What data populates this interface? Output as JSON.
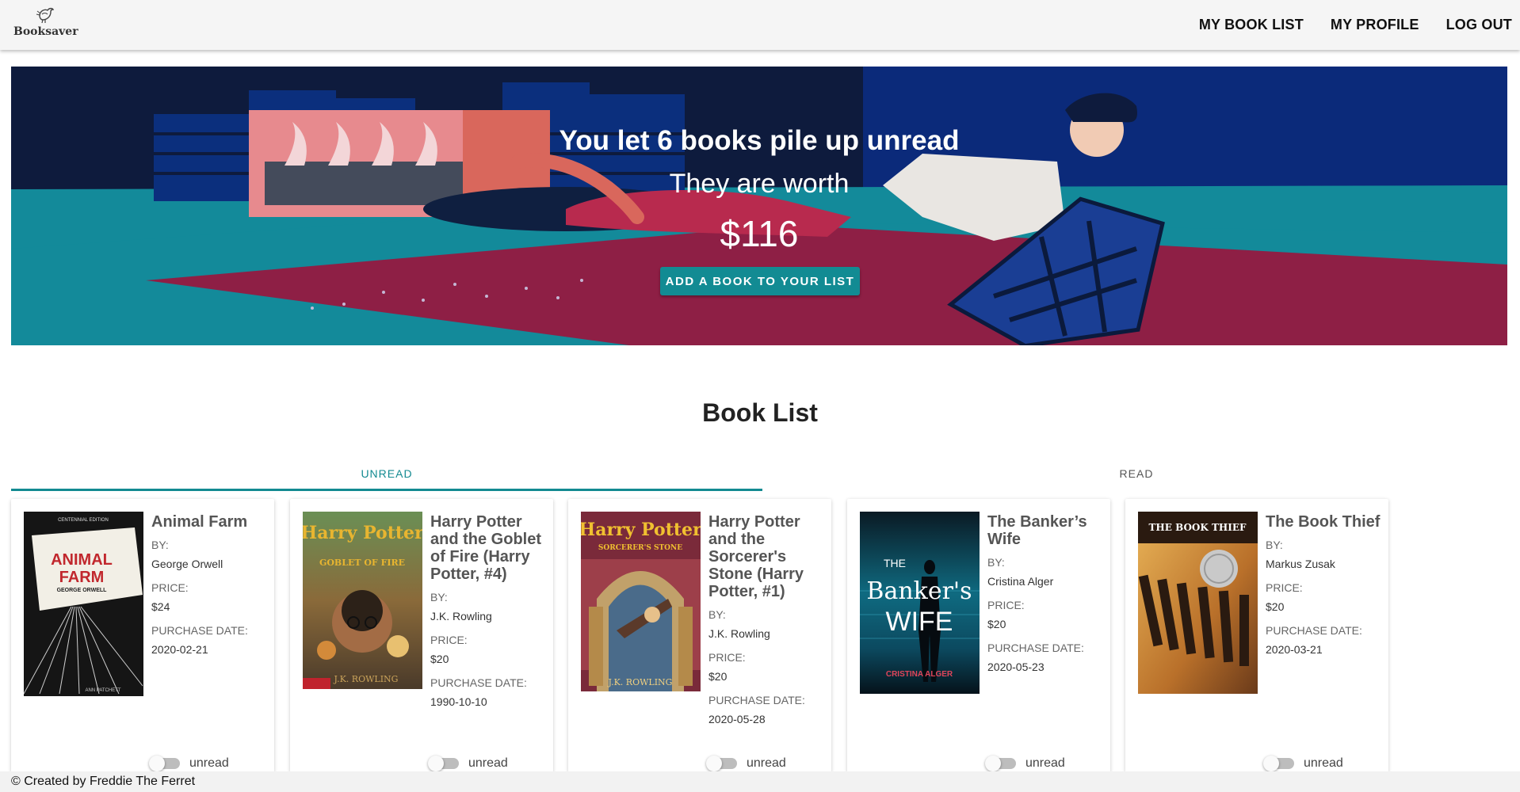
{
  "nav": {
    "logo_text": "Booksaver",
    "links": [
      {
        "label": "MY BOOK LIST"
      },
      {
        "label": "MY PROFILE"
      },
      {
        "label": "LOG OUT"
      }
    ]
  },
  "hero": {
    "title": "You let 6 books pile up unread",
    "subtitle": "They are worth",
    "amount": "$116",
    "button_label": "ADD A BOOK TO YOUR LIST"
  },
  "section": {
    "title": "Book List",
    "tabs": [
      {
        "label": "UNREAD",
        "active": true
      },
      {
        "label": "READ",
        "active": false
      }
    ]
  },
  "labels": {
    "by": "BY:",
    "price": "PRICE:",
    "purchase_date": "PURCHASE DATE:",
    "toggle": "unread"
  },
  "books": [
    {
      "title": "Animal Farm",
      "author": "George Orwell",
      "price": "$24",
      "purchase_date": "2020-02-21",
      "cover": {
        "top_text": "CENTENNIAL EDITION",
        "title_line1": "ANIMAL",
        "title_line2": "FARM",
        "author_text": "GEORGE ORWELL",
        "bottom_text": "ANN PATCHETT"
      }
    },
    {
      "title": "Harry Potter and the Goblet of Fire (Harry Potter, #4)",
      "author": "J.K. Rowling",
      "price": "$20",
      "purchase_date": "1990-10-10",
      "cover": {
        "title_line1": "Harry Potter",
        "title_line2": "GOBLET OF FIRE",
        "author_text": "J.K. ROWLING"
      }
    },
    {
      "title": "Harry Potter and the Sorcerer's Stone (Harry Potter, #1)",
      "author": "J.K. Rowling",
      "price": "$20",
      "purchase_date": "2020-05-28",
      "cover": {
        "title_line1": "Harry Potter",
        "title_line2": "SORCERER'S STONE",
        "author_text": "J.K. ROWLING"
      }
    },
    {
      "title": "The Banker’s Wife",
      "author": "Cristina Alger",
      "price": "$20",
      "purchase_date": "2020-05-23",
      "cover": {
        "title_line1": "THE",
        "title_line2": "Banker's",
        "title_line3": "WIFE",
        "author_text": "CRISTINA ALGER"
      }
    },
    {
      "title": "The Book Thief",
      "author": "Markus Zusak",
      "price": "$20",
      "purchase_date": "2020-03-21",
      "cover": {
        "title_line1": "THE BOOK THIEF"
      }
    }
  ],
  "footer": {
    "text": "© Created by Freddie The Ferret"
  },
  "colors": {
    "accent": "#128b93",
    "hero_navy": "#0b2a7a",
    "hero_teal": "#138a9a",
    "hero_crimson": "#8e1f45"
  }
}
